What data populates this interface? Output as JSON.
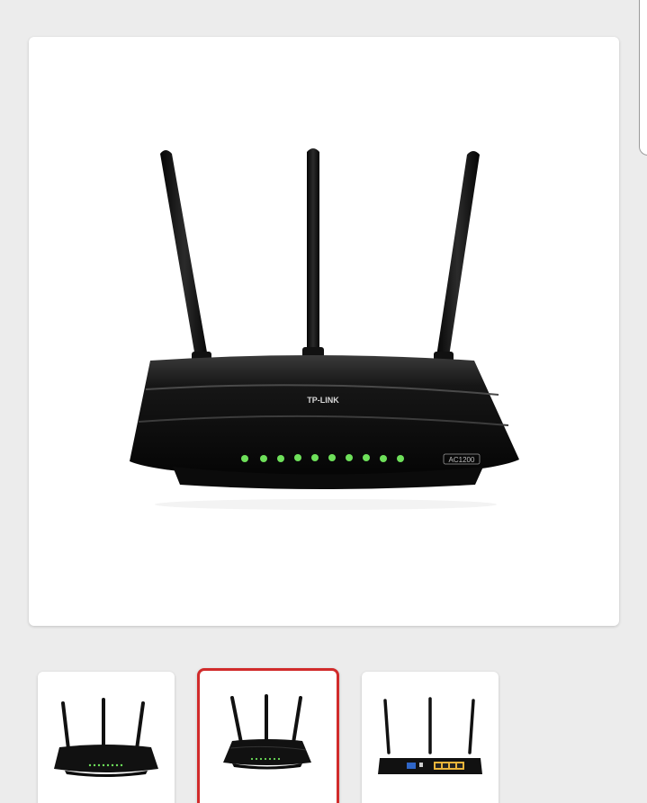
{
  "product": {
    "main_image": {
      "icon": "router-image",
      "brand_label": "TP-LINK",
      "model_badge": "AC1200",
      "led_color": "#6ee05a"
    },
    "thumbnails": [
      {
        "icon": "router-image",
        "view": "front-angle",
        "selected": false
      },
      {
        "icon": "router-image",
        "view": "front",
        "selected": true
      },
      {
        "icon": "router-image",
        "view": "back",
        "selected": false
      }
    ],
    "selected_border_color": "#d12b2b"
  }
}
